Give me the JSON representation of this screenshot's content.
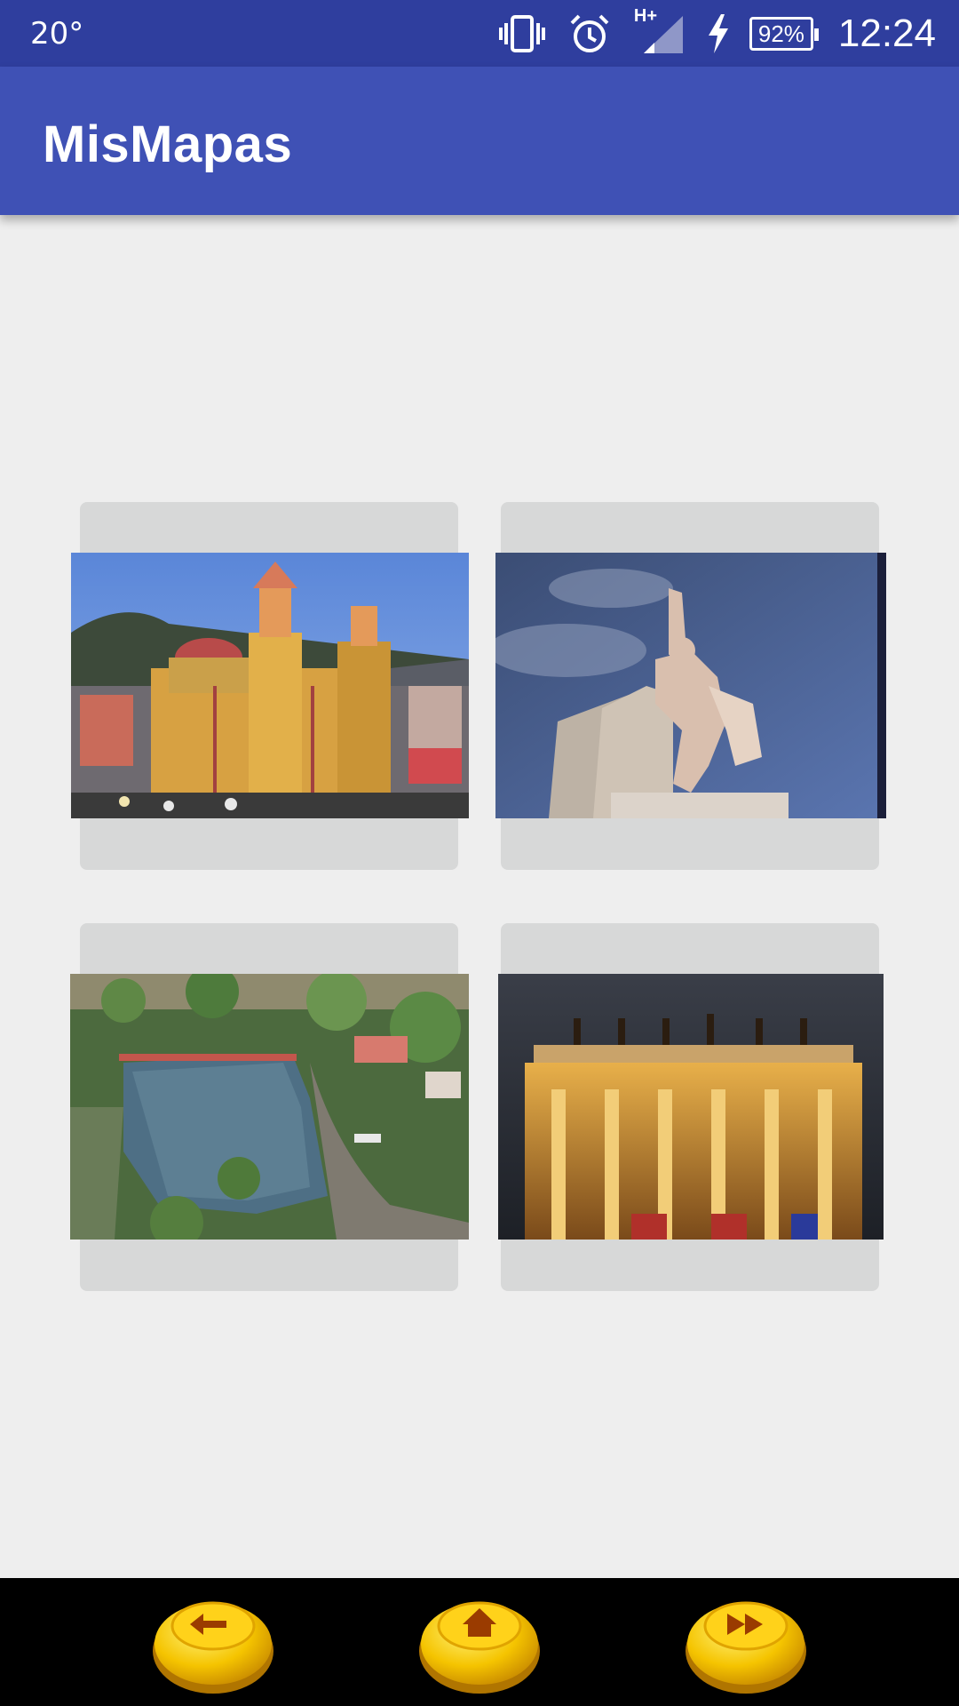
{
  "status_bar": {
    "temperature": "20°",
    "battery_percent": "92%",
    "time": "12:24",
    "network_label": "H+",
    "icons": [
      "vibrate-icon",
      "alarm-icon",
      "signal-icon",
      "charging-icon",
      "battery-icon"
    ]
  },
  "app_bar": {
    "title": "MisMapas",
    "color": "#3f51b5",
    "status_color": "#2f3e9e"
  },
  "gallery": {
    "items": [
      {
        "name": "basilica-photo"
      },
      {
        "name": "statue-photo"
      },
      {
        "name": "lake-photo"
      },
      {
        "name": "theater-photo"
      }
    ]
  },
  "bottom_nav": {
    "buttons": [
      {
        "name": "back-button",
        "icon": "arrow-left-icon"
      },
      {
        "name": "home-button",
        "icon": "home-icon"
      },
      {
        "name": "forward-button",
        "icon": "fast-forward-icon"
      }
    ],
    "button_color": "#f5c400"
  }
}
